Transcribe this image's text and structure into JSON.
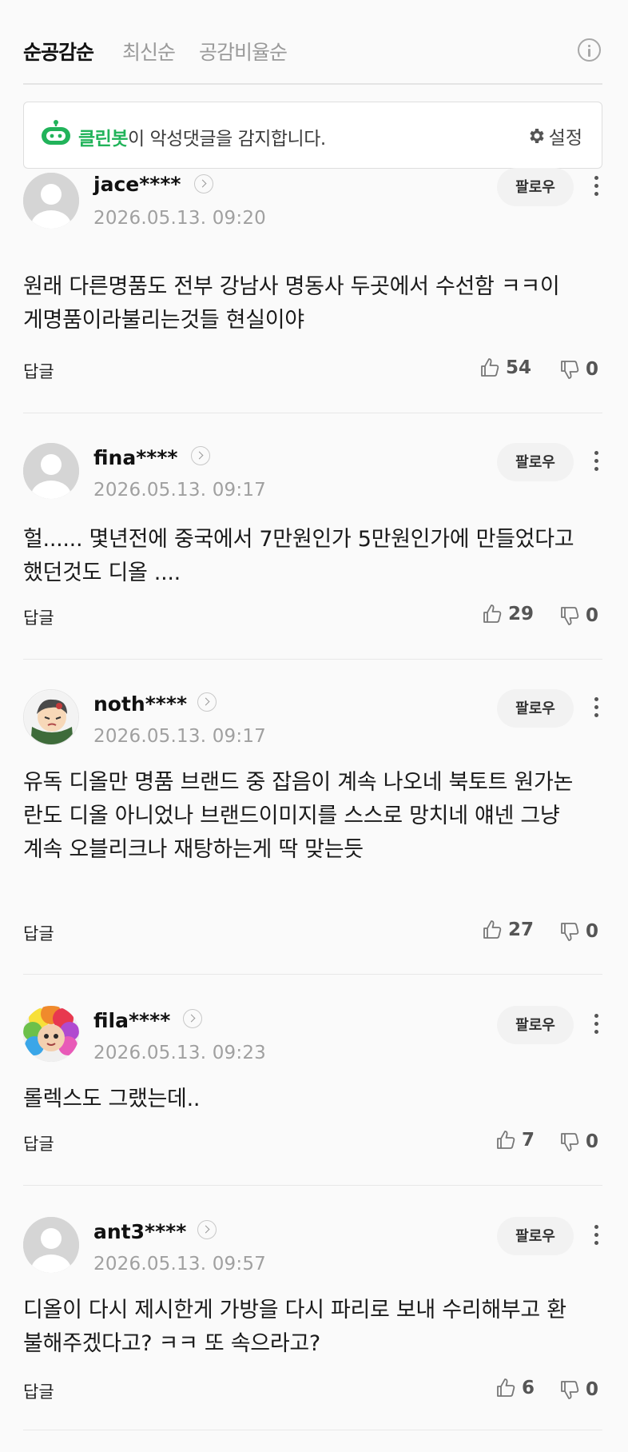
{
  "sort_tabs": [
    {
      "label": "순공감순",
      "active": true
    },
    {
      "label": "최신순",
      "active": false
    },
    {
      "label": "공감비율순",
      "active": false
    }
  ],
  "cleanbot": {
    "name": "클린봇",
    "message": "이 악성댓글을 감지합니다.",
    "settings_label": "설정"
  },
  "follow_label": "팔로우",
  "reply_label": "답글",
  "comments": [
    {
      "username": "jace****",
      "timestamp": "2026.05.13. 09:20",
      "text": "원래 다른명품도 전부 강남사 명동사 두곳에서 수선함 ㅋㅋ이게명품이라불리는것들 현실이야",
      "likes": "54",
      "dislikes": "0",
      "avatar": "default"
    },
    {
      "username": "fina****",
      "timestamp": "2026.05.13. 09:17",
      "text": "헐...... 몇년전에 중국에서 7만원인가 5만원인가에 만들었다고 했던것도 디올 ....",
      "likes": "29",
      "dislikes": "0",
      "avatar": "default"
    },
    {
      "username": "noth****",
      "timestamp": "2026.05.13. 09:17",
      "text": "유독 디올만 명품 브랜드 중 잡음이 계속 나오네 북토트 원가논란도 디올 아니었나 브랜드이미지를 스스로 망치네 얘넨 그냥 계속 오블리크나 재탕하는게 딱 맞는듯",
      "likes": "27",
      "dislikes": "0",
      "avatar": "character"
    },
    {
      "username": "fila****",
      "timestamp": "2026.05.13. 09:23",
      "text": "롤렉스도 그랬는데..",
      "likes": "7",
      "dislikes": "0",
      "avatar": "rainbow"
    },
    {
      "username": "ant3****",
      "timestamp": "2026.05.13. 09:57",
      "text": "디올이 다시 제시한게 가방을 다시 파리로 보내 수리해부고 환불해주겠다고? ㅋㅋ 또 속으라고?",
      "likes": "6",
      "dislikes": "0",
      "avatar": "default"
    }
  ],
  "colors": {
    "cleanbot_green": "#21b35a",
    "background": "#fafafa"
  }
}
